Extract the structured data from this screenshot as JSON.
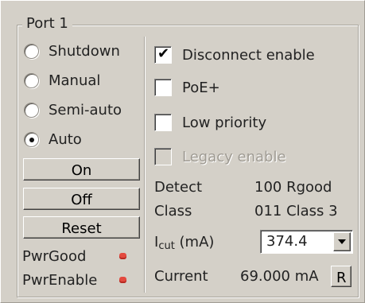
{
  "group": {
    "title": "Port 1"
  },
  "modes": [
    {
      "label": "Shutdown",
      "checked": false
    },
    {
      "label": "Manual",
      "checked": false
    },
    {
      "label": "Semi-auto",
      "checked": false
    },
    {
      "label": "Auto",
      "checked": true
    }
  ],
  "buttons": {
    "on": "On",
    "off": "Off",
    "reset": "Reset"
  },
  "status": {
    "pwr_good": "PwrGood",
    "pwr_enable": "PwrEnable",
    "led_color": "#e34a3f"
  },
  "options": [
    {
      "label": "Disconnect enable",
      "checked": true,
      "enabled": true
    },
    {
      "label": "PoE+",
      "checked": false,
      "enabled": true
    },
    {
      "label": "Low priority",
      "checked": false,
      "enabled": true
    },
    {
      "label": "Legacy enable",
      "checked": false,
      "enabled": false
    }
  ],
  "info": {
    "detect_label": "Detect",
    "detect_value": "100 Rgood",
    "class_label": "Class",
    "class_value": "011 Class 3",
    "icut_label_main": "I",
    "icut_label_sub": "cut",
    "icut_label_unit": " (mA)",
    "icut_value": "374.4",
    "current_label": "Current",
    "current_value": "69.000 mA",
    "refresh_button": "R"
  }
}
